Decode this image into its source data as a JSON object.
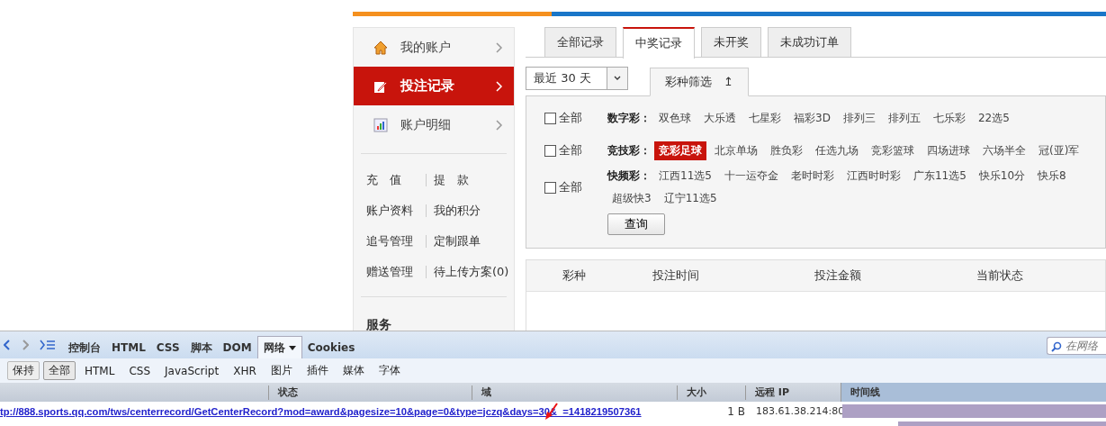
{
  "sidebar": {
    "nav": [
      {
        "label": "我的账户",
        "selected": false
      },
      {
        "label": "投注记录",
        "selected": true
      },
      {
        "label": "账户明细",
        "selected": false
      }
    ],
    "links": [
      [
        "充　值",
        "提　款"
      ],
      [
        "账户资料",
        "我的积分"
      ],
      [
        "追号管理",
        "定制跟单"
      ],
      [
        "赠送管理",
        "待上传方案(0)"
      ]
    ],
    "section": "服务"
  },
  "tabs": [
    {
      "label": "全部记录",
      "selected": false
    },
    {
      "label": "中奖记录",
      "selected": true
    },
    {
      "label": "未开奖",
      "selected": false
    },
    {
      "label": "未成功订单",
      "selected": false
    }
  ],
  "date_select": {
    "value": "最近 30 天"
  },
  "filter_tab": {
    "label": "彩种筛选",
    "arrow": "↥"
  },
  "filter_groups": [
    {
      "all_label": "全部",
      "all_checked": false,
      "category": "数字彩：",
      "items": [
        {
          "label": "双色球",
          "selected": false
        },
        {
          "label": "大乐透",
          "selected": false
        },
        {
          "label": "七星彩",
          "selected": false
        },
        {
          "label": "福彩3D",
          "selected": false
        },
        {
          "label": "排列三",
          "selected": false
        },
        {
          "label": "排列五",
          "selected": false
        },
        {
          "label": "七乐彩",
          "selected": false
        },
        {
          "label": "22选5",
          "selected": false
        }
      ]
    },
    {
      "all_label": "全部",
      "all_checked": false,
      "category": "竞技彩：",
      "items": [
        {
          "label": "竞彩足球",
          "selected": true
        },
        {
          "label": "北京单场",
          "selected": false
        },
        {
          "label": "胜负彩",
          "selected": false
        },
        {
          "label": "任选九场",
          "selected": false
        },
        {
          "label": "竞彩篮球",
          "selected": false
        },
        {
          "label": "四场进球",
          "selected": false
        },
        {
          "label": "六场半全",
          "selected": false
        },
        {
          "label": "冠(亚)军",
          "selected": false
        }
      ]
    },
    {
      "all_label": "全部",
      "all_checked": false,
      "category": "快频彩：",
      "items": [
        {
          "label": "江西11选5",
          "selected": false
        },
        {
          "label": "十一运夺金",
          "selected": false
        },
        {
          "label": "老时时彩",
          "selected": false
        },
        {
          "label": "江西时时彩",
          "selected": false
        },
        {
          "label": "广东11选5",
          "selected": false
        },
        {
          "label": "快乐10分",
          "selected": false
        },
        {
          "label": "快乐8",
          "selected": false
        }
      ],
      "more_items": [
        {
          "label": "超级快3",
          "selected": false
        },
        {
          "label": "辽宁11选5",
          "selected": false
        }
      ]
    }
  ],
  "query_button": "查询",
  "table": {
    "columns": [
      "彩种",
      "投注时间",
      "投注金额",
      "当前状态"
    ]
  },
  "devtools": {
    "tabs": [
      {
        "label": "控制台",
        "selected": false
      },
      {
        "label": "HTML",
        "selected": false
      },
      {
        "label": "CSS",
        "selected": false
      },
      {
        "label": "脚本",
        "selected": false
      },
      {
        "label": "DOM",
        "selected": false
      },
      {
        "label": "网络",
        "selected": true
      },
      {
        "label": "Cookies",
        "selected": false
      }
    ],
    "search_placeholder": "在网络",
    "persist_button": "保持",
    "filters": [
      {
        "label": "全部",
        "selected": true
      },
      {
        "label": "HTML",
        "selected": false
      },
      {
        "label": "CSS",
        "selected": false
      },
      {
        "label": "JavaScript",
        "selected": false
      },
      {
        "label": "XHR",
        "selected": false
      },
      {
        "label": "图片",
        "selected": false
      },
      {
        "label": "插件",
        "selected": false
      },
      {
        "label": "媒体",
        "selected": false
      },
      {
        "label": "字体",
        "selected": false
      }
    ],
    "columns": [
      "状态",
      "域",
      "大小",
      "远程 IP",
      "时间线"
    ],
    "rows": [
      {
        "url": "tp://888.sports.qq.com/tws/centerrecord/GetCenterRecord?mod=award&pagesize=10&page=0&type=jczq&days=30&_=1418219507361",
        "size": "1 B",
        "ip": "183.61.38.214:80"
      }
    ]
  }
}
